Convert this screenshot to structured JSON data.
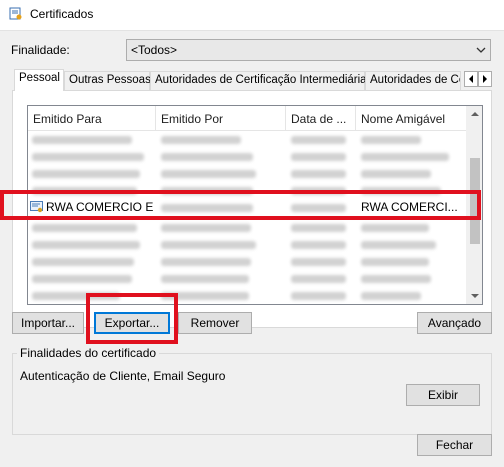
{
  "window": {
    "title": "Certificados"
  },
  "purpose": {
    "label": "Finalidade:",
    "selected": "<Todos>"
  },
  "tabs": [
    {
      "label": "Pessoal"
    },
    {
      "label": "Outras Pessoas"
    },
    {
      "label": "Autoridades de Certificação Intermediárias"
    },
    {
      "label": "Autoridades de Ce"
    }
  ],
  "list": {
    "columns": [
      "Emitido Para",
      "Emitido Por",
      "Data de ...",
      "Nome Amigável"
    ],
    "selected_row": {
      "issued_to": "RWA COMERCIO E ...",
      "issued_by": "",
      "date": "",
      "friendly_name": "RWA COMERCI..."
    }
  },
  "buttons": {
    "import": "Importar...",
    "export": "Exportar...",
    "remove": "Remover",
    "advanced": "Avançado",
    "view": "Exibir",
    "close": "Fechar"
  },
  "purposes_group": {
    "title": "Finalidades do certificado",
    "text": "Autenticação de Cliente, Email Seguro"
  },
  "colors": {
    "highlight": "#e0101e",
    "accent": "#0078d7"
  },
  "icons": [
    "certificate-manager-icon",
    "dropdown-arrow-icon",
    "tab-scroll-left-icon",
    "tab-scroll-right-icon",
    "certificate-icon",
    "scroll-up-icon",
    "scroll-down-icon"
  ]
}
